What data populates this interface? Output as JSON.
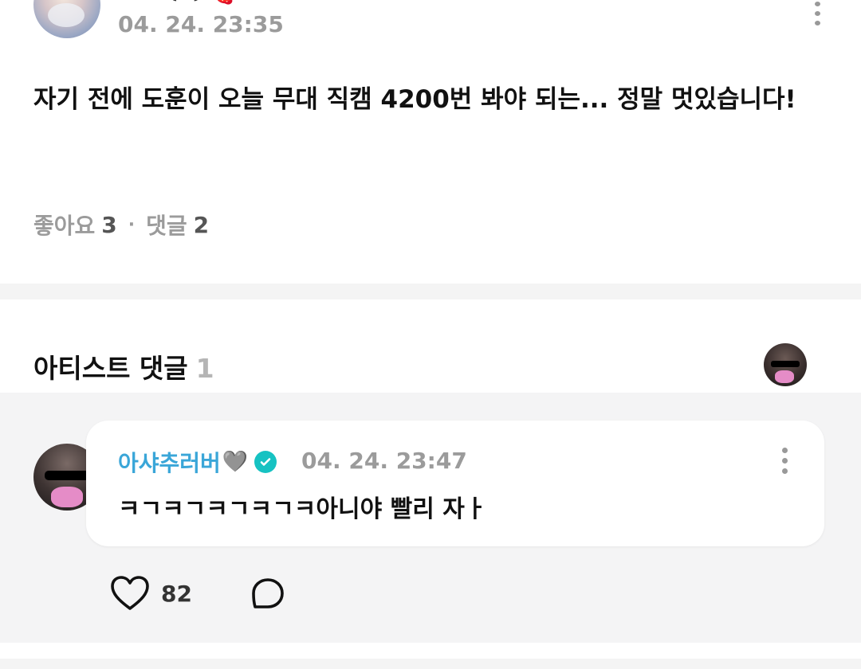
{
  "post": {
    "author_name_partial": "····· ꒰ ꒱ 🍓",
    "timestamp": "04. 24. 23:35",
    "body": "자기 전에 도훈이 오늘 무대 직캠 4200번 봐야 되는... 정말 멋있습니다!",
    "likes_label": "좋아요",
    "likes_count": "3",
    "comments_label": "댓글",
    "comments_count": "2"
  },
  "artist_comments": {
    "title": "아티스트 댓글",
    "count": "1"
  },
  "comment": {
    "author": "아샤추러버",
    "author_heart": "🩶",
    "timestamp": "04. 24. 23:47",
    "text": "ㅋㄱㅋㄱㅋㄱㅋㄱㅋ아니야 빨리 자ㅏ",
    "like_count": "82"
  },
  "icons": {
    "more": "more-vertical-icon",
    "verified": "verified-badge-icon",
    "heart": "heart-outline-icon",
    "reply": "speech-bubble-icon"
  },
  "colors": {
    "accent": "#3aa6d8",
    "verified": "#16c2c2",
    "muted": "#9b9b9b"
  }
}
